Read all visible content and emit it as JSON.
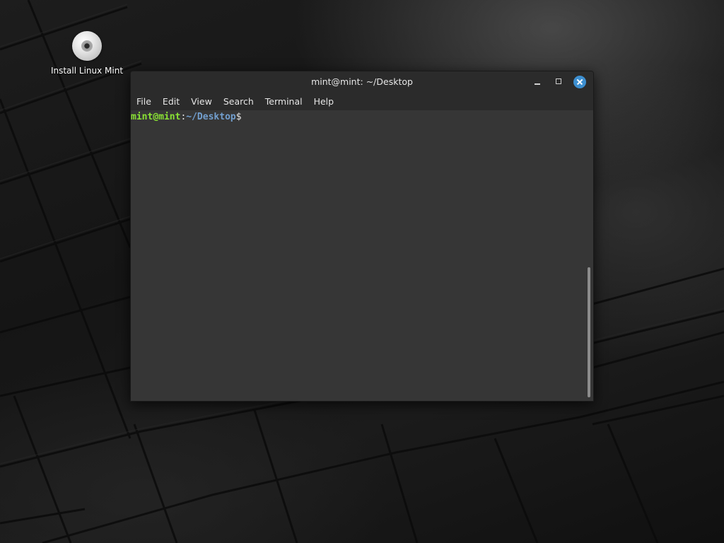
{
  "desktop": {
    "icons": [
      {
        "label": "Install Linux Mint",
        "icon": "disc-icon"
      }
    ]
  },
  "window": {
    "title": "mint@mint: ~/Desktop",
    "controls": {
      "minimize": "minimize-icon",
      "maximize": "maximize-icon",
      "close": "close-icon"
    },
    "menu": [
      {
        "label": "File"
      },
      {
        "label": "Edit"
      },
      {
        "label": "View"
      },
      {
        "label": "Search"
      },
      {
        "label": "Terminal"
      },
      {
        "label": "Help"
      }
    ],
    "terminal": {
      "prompt_user": "mint@mint",
      "prompt_colon": ":",
      "prompt_path": "~/Desktop",
      "prompt_symbol": "$"
    }
  },
  "colors": {
    "close_button": "#3d8fd0",
    "prompt_user": "#8ae234",
    "prompt_path": "#729fcf",
    "terminal_bg": "#363636",
    "titlebar_bg": "#2b2b2b"
  }
}
